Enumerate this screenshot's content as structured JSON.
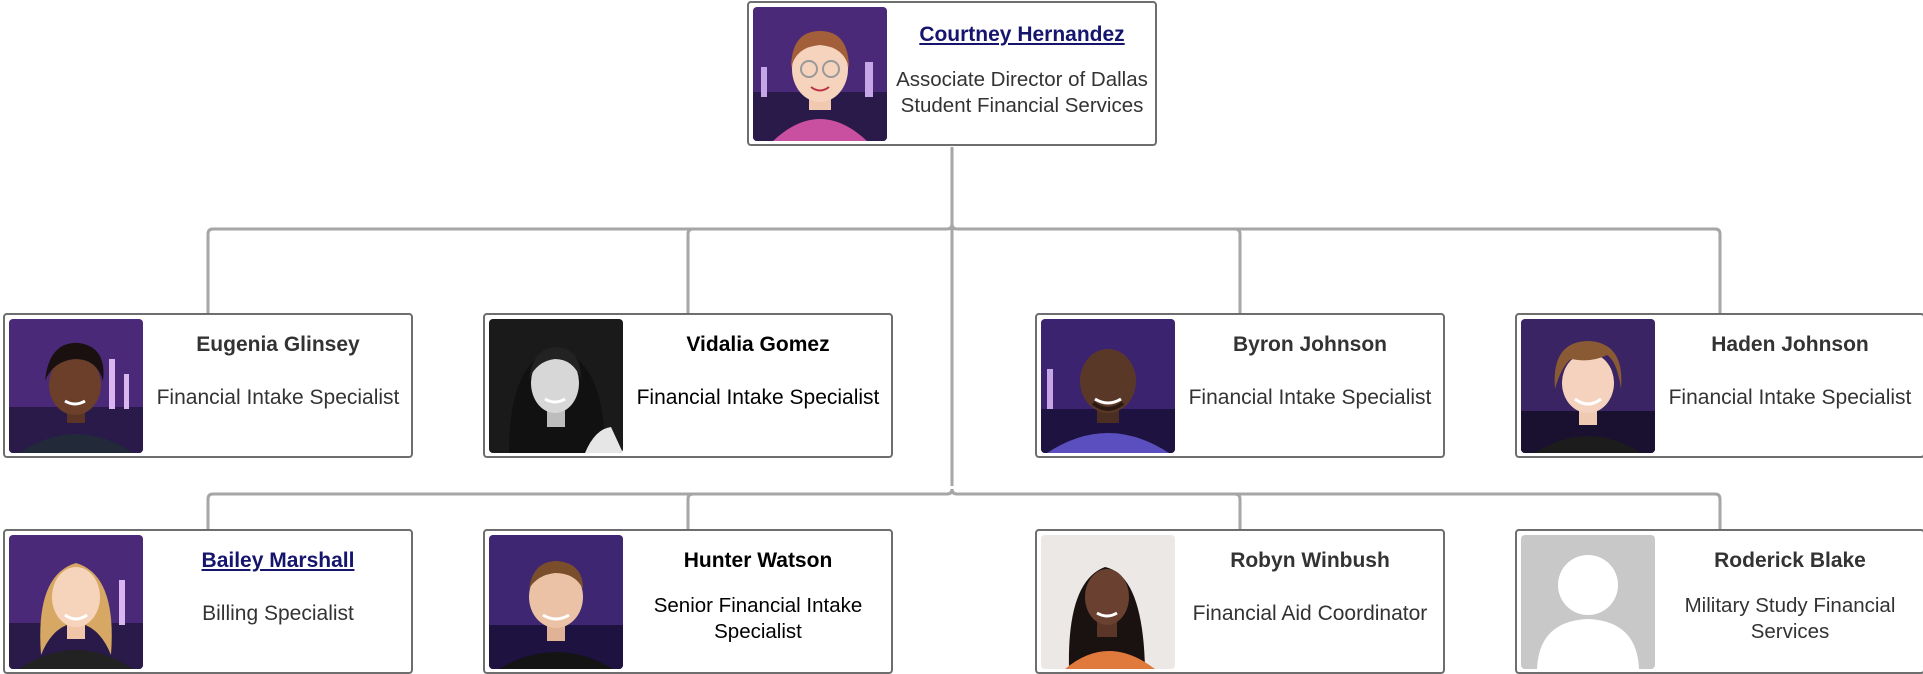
{
  "manager": {
    "name": "Courtney Hernandez",
    "title": "Associate Director of Dallas Student Financial Services"
  },
  "row1": [
    {
      "name": "Eugenia Glinsey",
      "title": "Financial Intake Specialist"
    },
    {
      "name": "Vidalia Gomez",
      "title": "Financial Intake Specialist"
    },
    {
      "name": "Byron Johnson",
      "title": "Financial Intake Specialist"
    },
    {
      "name": "Haden Johnson",
      "title": "Financial Intake Specialist"
    }
  ],
  "row2": [
    {
      "name": "Bailey Marshall",
      "title": "Billing Specialist"
    },
    {
      "name": "Hunter Watson",
      "title": "Senior Financial Intake Specialist"
    },
    {
      "name": "Robyn Winbush",
      "title": "Financial Aid Coordinator"
    },
    {
      "name": "Roderick Blake",
      "title": "Military Study Financial Services"
    }
  ],
  "colors": {
    "connector": "#a6a6a6",
    "card_border": "#6e6e6e",
    "link": "#15156e",
    "photo_bg": "#4a2a78"
  }
}
